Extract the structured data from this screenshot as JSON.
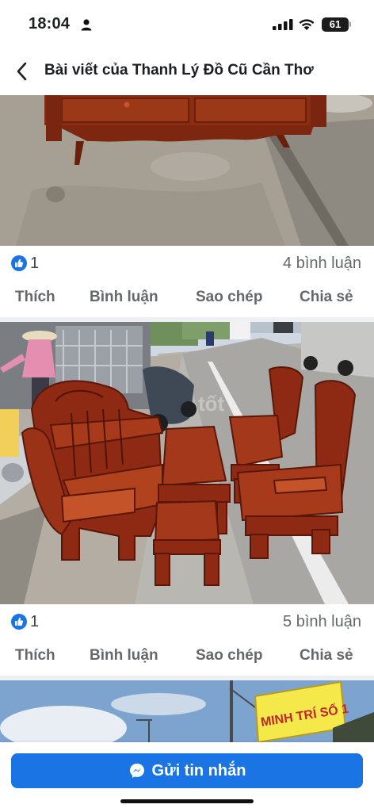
{
  "status_bar": {
    "time": "18:04",
    "battery": "61"
  },
  "header": {
    "back_icon": "chevron-left-icon",
    "title": "Bài viết của Thanh Lý Đồ Cũ Cần Thơ"
  },
  "posts": [
    {
      "likes": "1",
      "comments": "4 bình luận",
      "actions": [
        "Thích",
        "Bình luận",
        "Sao chép",
        "Chia sẻ"
      ]
    },
    {
      "likes": "1",
      "comments": "5 bình luận",
      "actions": [
        "Thích",
        "Bình luận",
        "Sao chép",
        "Chia sẻ"
      ]
    }
  ],
  "photo3": {
    "sign_text": "MINH TRÍ SỐ 1"
  },
  "footer": {
    "send_label": "Gửi tin nhắn",
    "send_icon": "messenger-icon"
  },
  "colors": {
    "accent": "#1b74e4",
    "text_secondary": "#65676b",
    "wood": "#8e2a14"
  }
}
